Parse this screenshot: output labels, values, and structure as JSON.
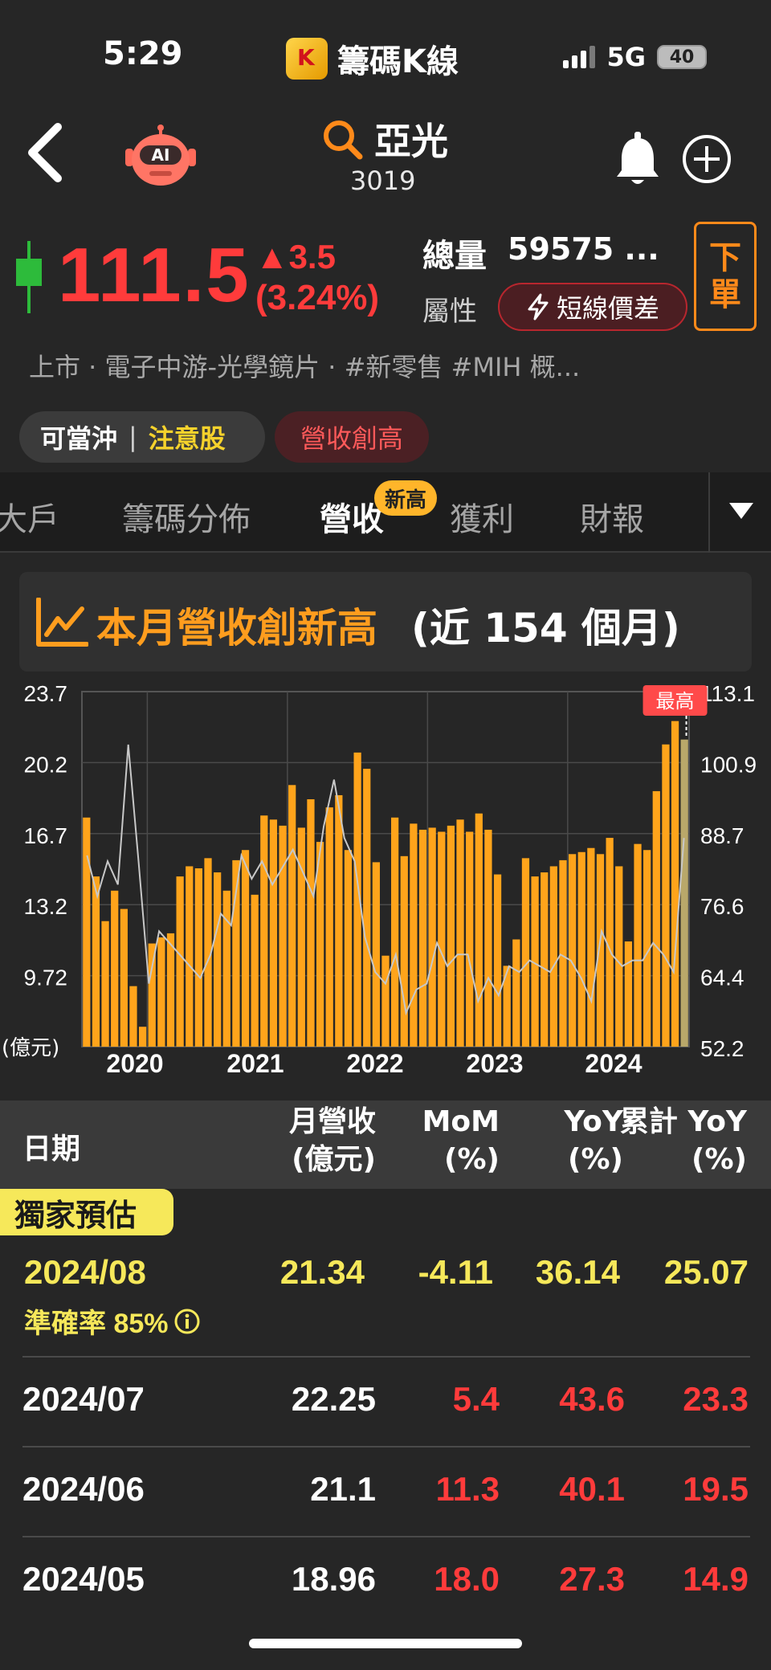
{
  "status": {
    "time": "5:29",
    "app_name": "籌碼K線",
    "network": "5G",
    "battery": "40"
  },
  "header": {
    "stock_name": "亞光",
    "stock_code": "3019"
  },
  "quote": {
    "price": "111.5",
    "change": "3.5",
    "change_pct": "(3.24%)",
    "volume_label": "總量",
    "volume_value": "59575 ...",
    "attr_label": "屬性",
    "attr_badge": "短線價差",
    "order_button": [
      "下",
      "單"
    ],
    "tags_line": "上市 · 電子中游-光學鏡片 · #新零售 #MIH 概..."
  },
  "pills": {
    "day_trade": "可當沖",
    "watch": "注意股",
    "revenue_high": "營收創高"
  },
  "tabs": [
    {
      "label": "大戶"
    },
    {
      "label": "籌碼分佈"
    },
    {
      "label": "營收",
      "badge": "新高"
    },
    {
      "label": "獲利"
    },
    {
      "label": "財報"
    }
  ],
  "banner": {
    "title": "本月營收創新高",
    "subtitle": "(近 154 個月)"
  },
  "chart_data": {
    "type": "bar",
    "series": [
      {
        "type": "bar",
        "axis": "left",
        "color": "#ffa41b",
        "values": [
          17.5,
          14.6,
          12.4,
          13.9,
          13.0,
          9.2,
          7.2,
          11.3,
          11.6,
          11.8,
          14.6,
          15.1,
          15.0,
          15.5,
          14.8,
          13.9,
          15.4,
          15.9,
          13.7,
          17.6,
          17.4,
          17.1,
          19.1,
          17.0,
          18.4,
          16.3,
          18.0,
          18.6,
          15.9,
          20.7,
          19.9,
          15.3,
          10.7,
          17.5,
          15.6,
          17.2,
          16.9,
          17.0,
          16.8,
          17.1,
          17.4,
          16.8,
          17.7,
          16.9,
          14.7,
          10.2,
          11.5,
          15.5,
          14.6,
          14.8,
          15.1,
          15.4,
          15.7,
          15.8,
          16.0,
          15.7,
          16.5,
          15.1,
          11.4,
          16.2,
          15.9,
          18.8,
          21.1,
          22.25,
          21.34
        ]
      },
      {
        "type": "line",
        "axis": "right",
        "color": "#c8c8c8",
        "values": [
          85,
          78,
          84,
          80,
          104,
          84,
          63,
          72,
          70,
          68,
          66,
          64,
          68,
          75,
          73,
          85,
          81,
          84,
          80,
          83,
          86,
          82,
          78,
          90,
          98,
          88,
          84,
          71,
          65,
          63,
          68,
          58,
          62,
          63,
          70,
          66,
          68,
          68,
          60,
          64,
          61,
          66,
          65,
          67,
          66,
          65,
          68,
          67,
          64,
          60,
          72,
          68,
          66,
          67,
          67,
          70,
          68,
          65,
          88
        ]
      }
    ],
    "x_ticks": [
      "2020",
      "2021",
      "2022",
      "2023",
      "2024"
    ],
    "y_left_ticks": [
      "23.7",
      "20.2",
      "16.7",
      "13.2",
      "9.72"
    ],
    "y_left_unit": "(億元)",
    "y_right_ticks": [
      "113.1",
      "100.9",
      "88.7",
      "76.6",
      "64.4",
      "52.2"
    ],
    "ylim_left": [
      6.22,
      23.7
    ],
    "ylim_right": [
      52.2,
      113.1
    ],
    "grid": true,
    "max_marker": "最高"
  },
  "table": {
    "headers": {
      "date": "日期",
      "revenue": [
        "月營收",
        "(億元)"
      ],
      "mom": [
        "MoM",
        "(%)"
      ],
      "yoy": [
        "YoY",
        "(%)"
      ],
      "cum_yoy": [
        "累計 YoY",
        "(%)"
      ]
    },
    "exclusive_tag": "獨家預估",
    "estimate": {
      "date": "2024/08",
      "revenue": "21.34",
      "mom": "-4.11",
      "yoy": "36.14",
      "cum_yoy": "25.07",
      "accuracy": "準確率 85%"
    },
    "rows": [
      {
        "date": "2024/07",
        "revenue": "22.25",
        "mom": "5.4",
        "yoy": "43.6",
        "cum_yoy": "23.3"
      },
      {
        "date": "2024/06",
        "revenue": "21.1",
        "mom": "11.3",
        "yoy": "40.1",
        "cum_yoy": "19.5"
      },
      {
        "date": "2024/05",
        "revenue": "18.96",
        "mom": "18.0",
        "yoy": "27.3",
        "cum_yoy": "14.9"
      }
    ]
  }
}
